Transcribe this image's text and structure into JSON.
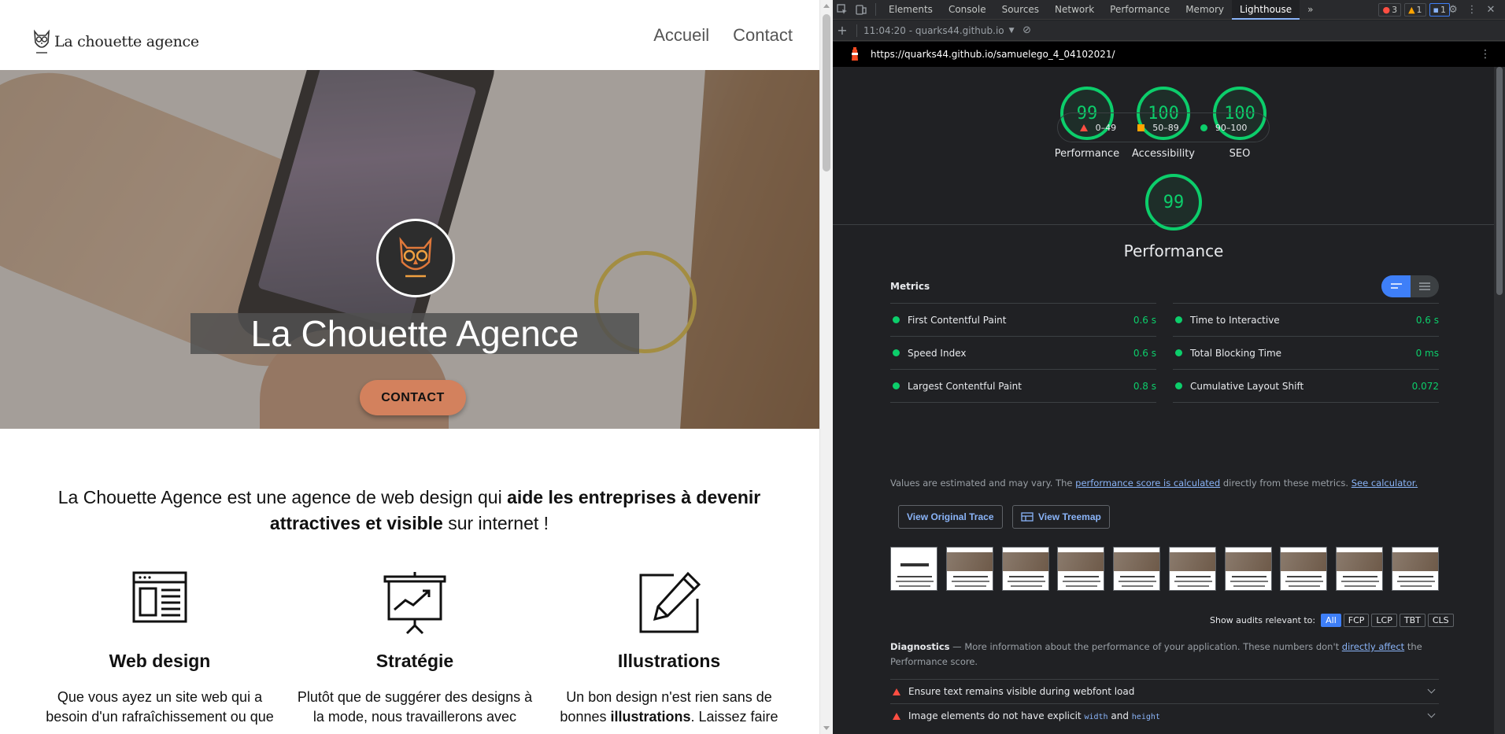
{
  "site": {
    "logo_text": "La chouette agence",
    "nav": [
      "Accueil",
      "Contact"
    ],
    "hero": {
      "title": "La Chouette Agence",
      "cta": "CONTACT"
    },
    "intro": {
      "part1": "La Chouette Agence est une agence de web design qui ",
      "bold1": "aide les entreprises à devenir attractives et visible",
      "part2": " sur internet !"
    },
    "services": [
      {
        "title": "Web design",
        "text": "Que vous ayez un site web qui a besoin d'un rafraîchissement ou que"
      },
      {
        "title": "Stratégie",
        "text": "Plutôt que de suggérer des designs à la mode, nous travaillerons avec"
      },
      {
        "title": "Illustrations",
        "text_before": "Un bon design n'est rien sans de bonnes ",
        "text_bold": "illustrations",
        "text_after": ". Laissez faire"
      }
    ]
  },
  "devtools": {
    "tabs": [
      "Elements",
      "Console",
      "Sources",
      "Network",
      "Performance",
      "Memory",
      "Lighthouse"
    ],
    "active_tab": "Lighthouse",
    "more_tabs": "»",
    "badges": {
      "errors": "3",
      "warnings": "1",
      "messages": "1"
    },
    "report_selector": "11:04:20 - quarks44.github.io",
    "url": "https://quarks44.github.io/samuelego_4_04102021/",
    "scores": [
      {
        "value": "99",
        "label": "Performance"
      },
      {
        "value": "100",
        "label": "Accessibility"
      },
      {
        "value": "100",
        "label": "SEO"
      }
    ],
    "legend": [
      "0–49",
      "50–89",
      "90–100"
    ],
    "main_score": {
      "value": "99",
      "label": "Performance"
    },
    "metrics_title": "Metrics",
    "metrics": [
      {
        "name": "First Contentful Paint",
        "value": "0.6 s"
      },
      {
        "name": "Time to Interactive",
        "value": "0.6 s"
      },
      {
        "name": "Speed Index",
        "value": "0.6 s"
      },
      {
        "name": "Total Blocking Time",
        "value": "0 ms"
      },
      {
        "name": "Largest Contentful Paint",
        "value": "0.8 s"
      },
      {
        "name": "Cumulative Layout Shift",
        "value": "0.072"
      }
    ],
    "note": {
      "prefix": "Values are estimated and may vary. The ",
      "link1": "performance score is calculated",
      "middle": " directly from these metrics. ",
      "link2": "See calculator."
    },
    "buttons": {
      "trace": "View Original Trace",
      "treemap": "View Treemap"
    },
    "audit_filter": {
      "label": "Show audits relevant to:",
      "chips": [
        "All",
        "FCP",
        "LCP",
        "TBT",
        "CLS"
      ]
    },
    "diagnostics": {
      "title": "Diagnostics",
      "dash": " — ",
      "text": "More information about the performance of your application. These numbers don't ",
      "link": "directly affect",
      "text2": " the Performance score."
    },
    "audits": [
      {
        "text": "Ensure text remains visible during webfont load"
      },
      {
        "prefix": "Image elements do not have explicit ",
        "code1": "width",
        "mid": " and ",
        "code2": "height"
      }
    ],
    "colors": {
      "pass": "#0cce6b",
      "average": "#ffa400",
      "fail": "#ff4e42",
      "accent": "#3e7ff8"
    }
  }
}
